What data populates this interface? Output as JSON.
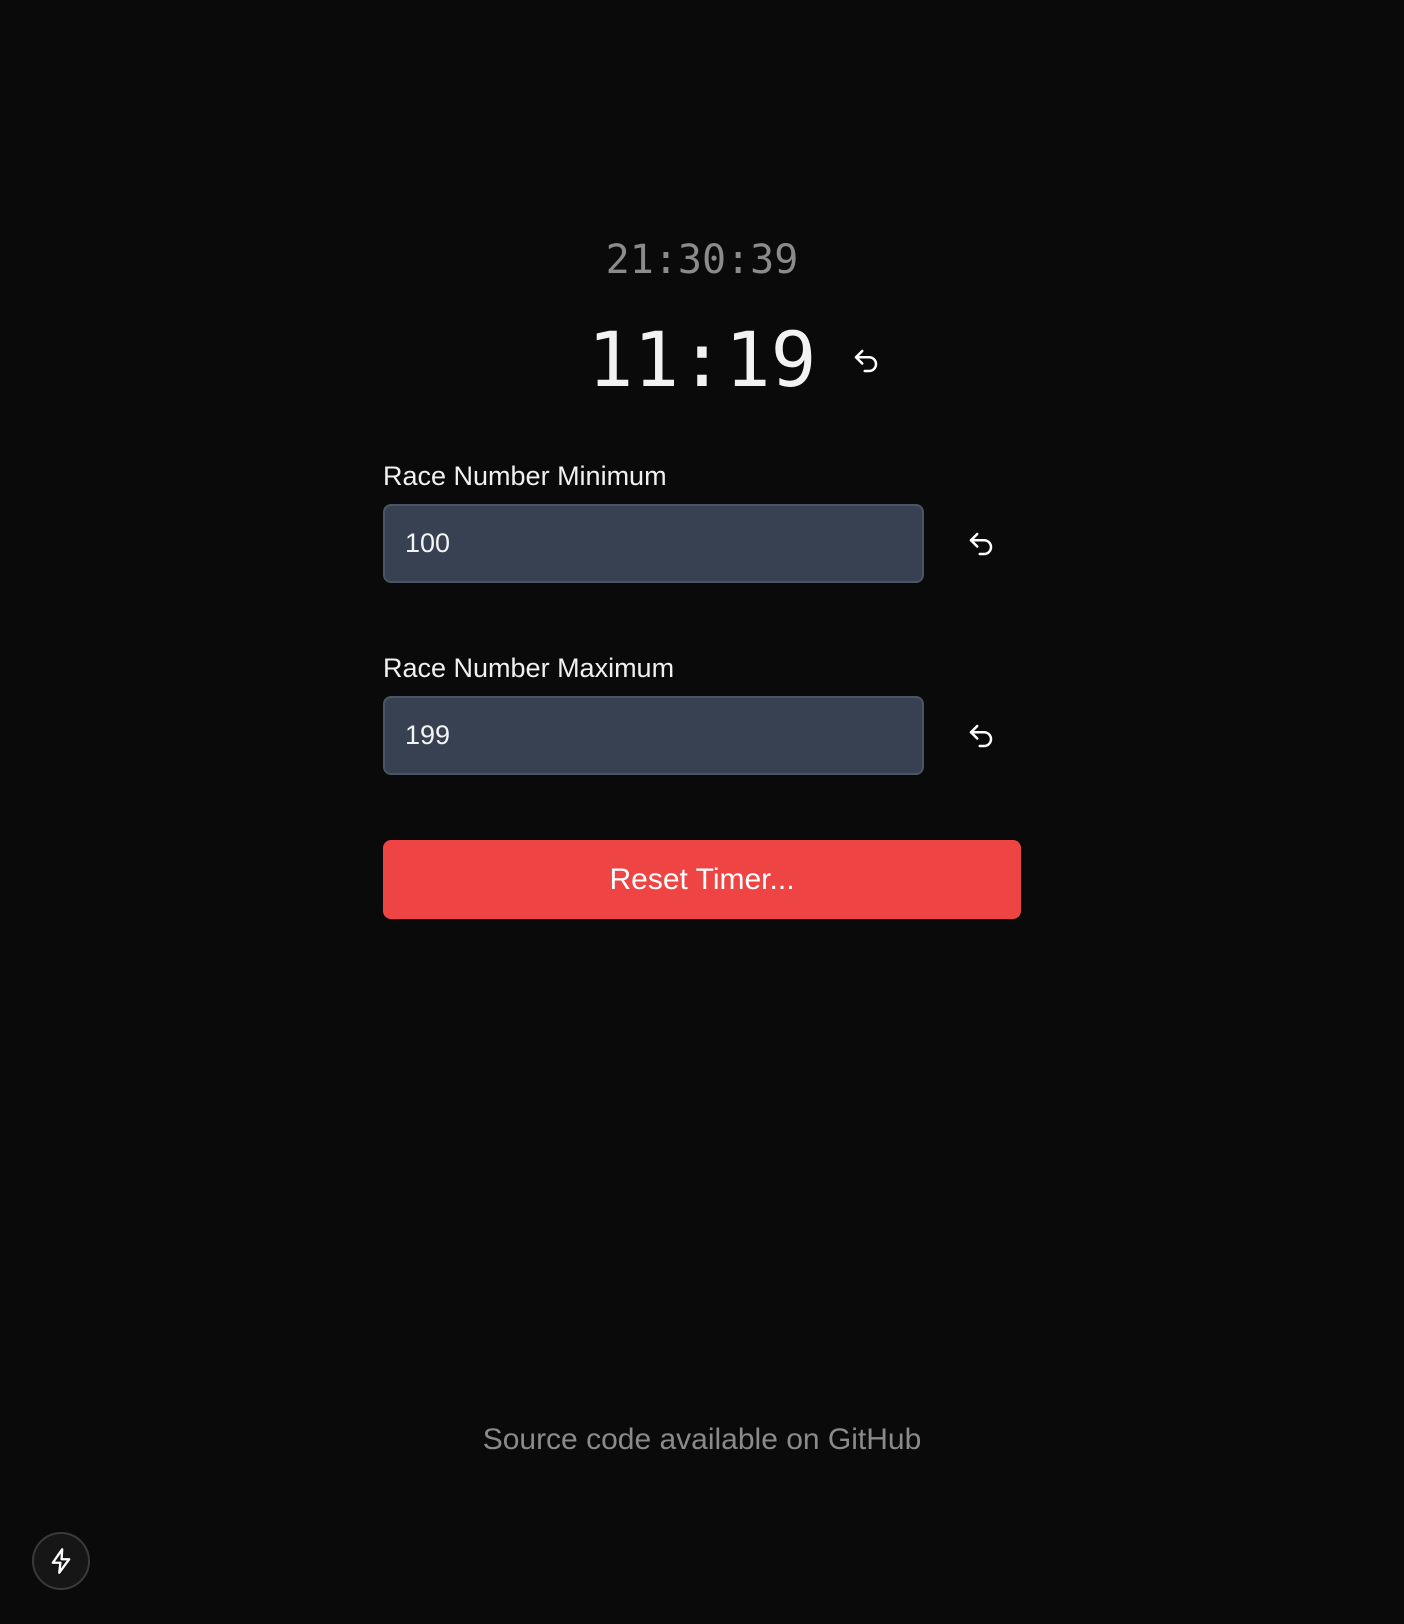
{
  "clock": {
    "time": "21:30:39"
  },
  "timer": {
    "value": "11:19",
    "reset_icon": "undo-icon"
  },
  "race_min": {
    "label": "Race Number Minimum",
    "value": "100",
    "reset_icon": "undo-icon"
  },
  "race_max": {
    "label": "Race Number Maximum",
    "value": "199",
    "reset_icon": "undo-icon"
  },
  "actions": {
    "reset_timer_label": "Reset Timer..."
  },
  "footer": {
    "text": "Source code available on GitHub"
  },
  "fab": {
    "icon": "lightning-bolt-icon"
  },
  "colors": {
    "background": "#0a0a0a",
    "input_bg": "#374151",
    "danger": "#ef4444",
    "muted_text": "#8a8a8a"
  }
}
